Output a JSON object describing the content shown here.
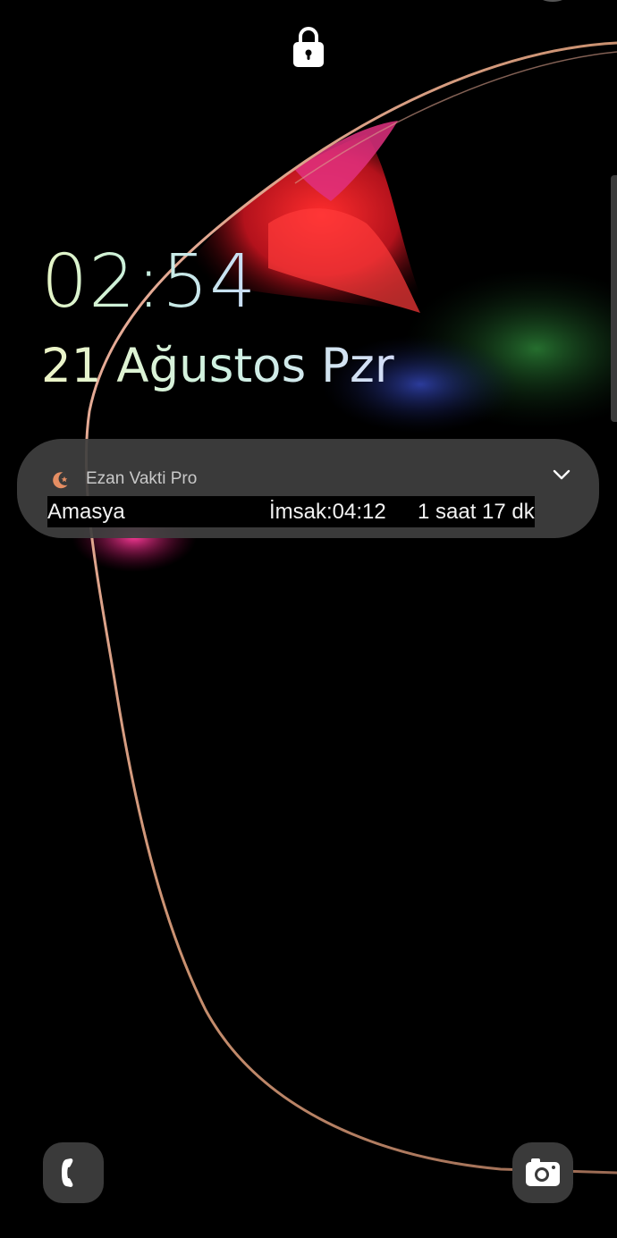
{
  "lockscreen": {
    "time": "02:54",
    "date": "21 Ağustos Pzr"
  },
  "notification": {
    "app_name": "Ezan Vakti Pro",
    "app_icon": "crescent-star-icon",
    "accent_color": "#e58e63",
    "city": "Amasya",
    "prayer_time": "İmsak:04:12",
    "remaining": "1 saat 17 dk",
    "expand_icon": "chevron-down-icon"
  },
  "shortcuts": {
    "left": "phone-icon",
    "right": "camera-icon"
  },
  "colors": {
    "background": "#000000",
    "notification_bg": "#3e3e3e",
    "wallpaper_red": "#e3262a",
    "wallpaper_magenta": "#e02a7c"
  }
}
